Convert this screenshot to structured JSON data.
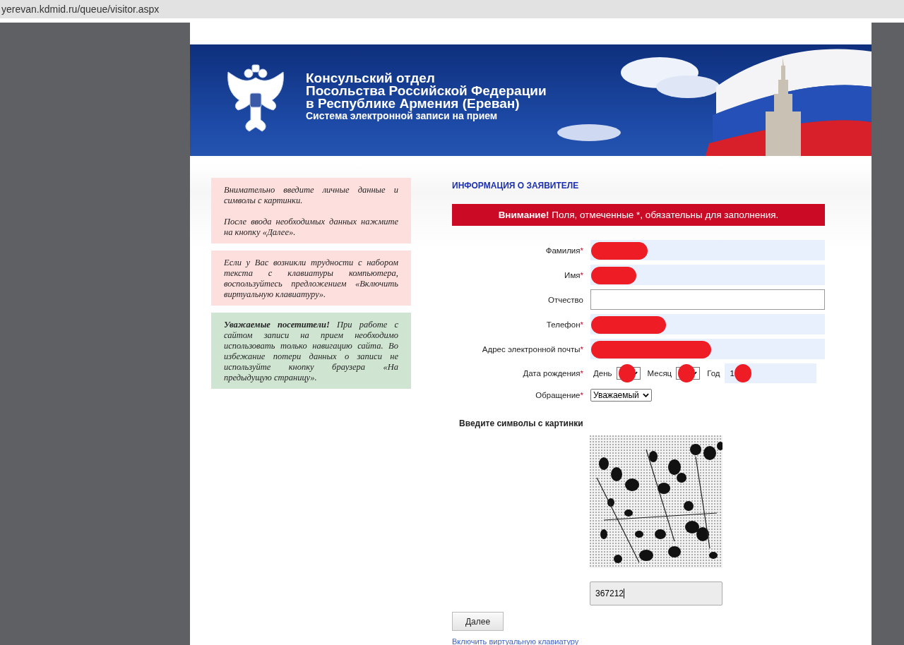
{
  "address_bar": {
    "url": "yerevan.kdmid.ru/queue/visitor.aspx"
  },
  "header": {
    "title_lines": [
      "Консульский отдел",
      "Посольства Российской Федерации",
      "в Республике Армения (Ереван)"
    ],
    "subtitle": "Система электронной записи на прием"
  },
  "notes": [
    {
      "color": "#fde0de",
      "paragraphs": [
        "Внимательно введите личные данные и символы с картинки.",
        "После ввода необходимых данных нажмите на кнопку «Далее»."
      ]
    },
    {
      "color": "#fde0de",
      "paragraphs": [
        "Если у Вас возникли трудности с набором текста с клавиатуры компьютера, воспользуйтесь предложением «Включить виртуальную клавиатуру»."
      ]
    },
    {
      "color": "#cfe5d2",
      "paragraphs": [
        "**Уважаемые посетители!** При работе с сайтом записи на прием необходимо использовать только навигацию сайта. Во избежание потери данных о записи не используйте кнопку браузера «На предыдущую страницу»."
      ]
    }
  ],
  "form": {
    "heading": "ИНФОРМАЦИЯ О ЗАЯВИТЕЛЕ",
    "alert": "**Внимание!** Поля, отмеченные *, обязательны для заполнения.",
    "required_mark": "*",
    "fields": [
      {
        "kind": "text",
        "label": "Фамилия",
        "required": true,
        "autofilled": true,
        "redacted": true
      },
      {
        "kind": "text",
        "label": "Имя",
        "required": true,
        "autofilled": true,
        "redacted": true
      },
      {
        "kind": "text",
        "label": "Отчество",
        "required": false,
        "autofilled": false,
        "redacted": false
      },
      {
        "kind": "text",
        "label": "Телефон",
        "required": true,
        "autofilled": true,
        "redacted": true
      },
      {
        "kind": "text",
        "label": "Адрес электронной почты",
        "required": true,
        "autofilled": true,
        "redacted": true
      },
      {
        "kind": "date",
        "label": "Дата рождения",
        "required": true,
        "parts": [
          {
            "kind": "select",
            "label": "День",
            "redacted": true
          },
          {
            "kind": "select",
            "label": "Месяц",
            "redacted": true
          },
          {
            "kind": "input",
            "label": "Год",
            "value": "1",
            "redacted": true
          }
        ]
      },
      {
        "kind": "select",
        "label": "Обращение",
        "required": true,
        "value": "Уважаемый"
      }
    ],
    "captcha": {
      "label": "Введите символы с картинки",
      "value": "367212"
    },
    "next_button": "Далее",
    "keyboard_link": "Включить виртуальную клавиатуру"
  }
}
